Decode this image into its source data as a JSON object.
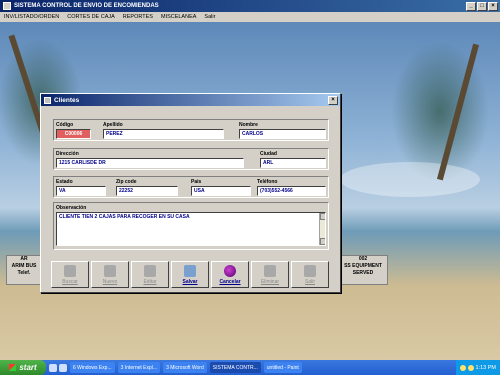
{
  "app": {
    "title": "SISTEMA CONTROL DE ENVIO DE ENCOMIENDAS",
    "menu": [
      "INV/LISTADO/ORDEN",
      "CORTES DE CAJA",
      "REPORTES",
      "MISCELANEA",
      "Salir"
    ]
  },
  "background_panels": {
    "left": [
      "AR",
      "ARIM BUS",
      "Telef."
    ],
    "right": [
      "002",
      "SS EQUIPMENT",
      "SERVED"
    ]
  },
  "dialog": {
    "title": "Clientes",
    "fields": {
      "codigo": {
        "label": "Código",
        "value": "C00006"
      },
      "apellido": {
        "label": "Apellido",
        "value": "PEREZ"
      },
      "nombre": {
        "label": "Nombre",
        "value": "CARLOS"
      },
      "direccion": {
        "label": "Dirección",
        "value": "1215 CARLISDE DR"
      },
      "ciudad": {
        "label": "Ciudad",
        "value": "ARL"
      },
      "estado": {
        "label": "Estado",
        "value": "VA"
      },
      "zip": {
        "label": "Zip code",
        "value": "22252"
      },
      "pais": {
        "label": "Pais",
        "value": "USA"
      },
      "telefono": {
        "label": "Teléfono",
        "value": "(703)552-4566"
      },
      "observacion": {
        "label": "Observación",
        "value": "CLIENTE TIEN 2 CAJAS PARA RECOGER EN SU CASA"
      }
    },
    "buttons": {
      "buscar": "Buscar",
      "nuevo": "Nuevo",
      "editar": "Editar",
      "salvar": "Salvar",
      "cancelar": "Cancelar",
      "eliminar": "Eliminar",
      "salir": "Salir"
    }
  },
  "taskbar": {
    "start": "start",
    "tasks": [
      "6 Windows Exp...",
      "3 Internet Expl...",
      "3 Microsoft Word",
      "SISTEMA CONTR...",
      "untitled - Paint"
    ],
    "clock": "1:13 PM"
  }
}
